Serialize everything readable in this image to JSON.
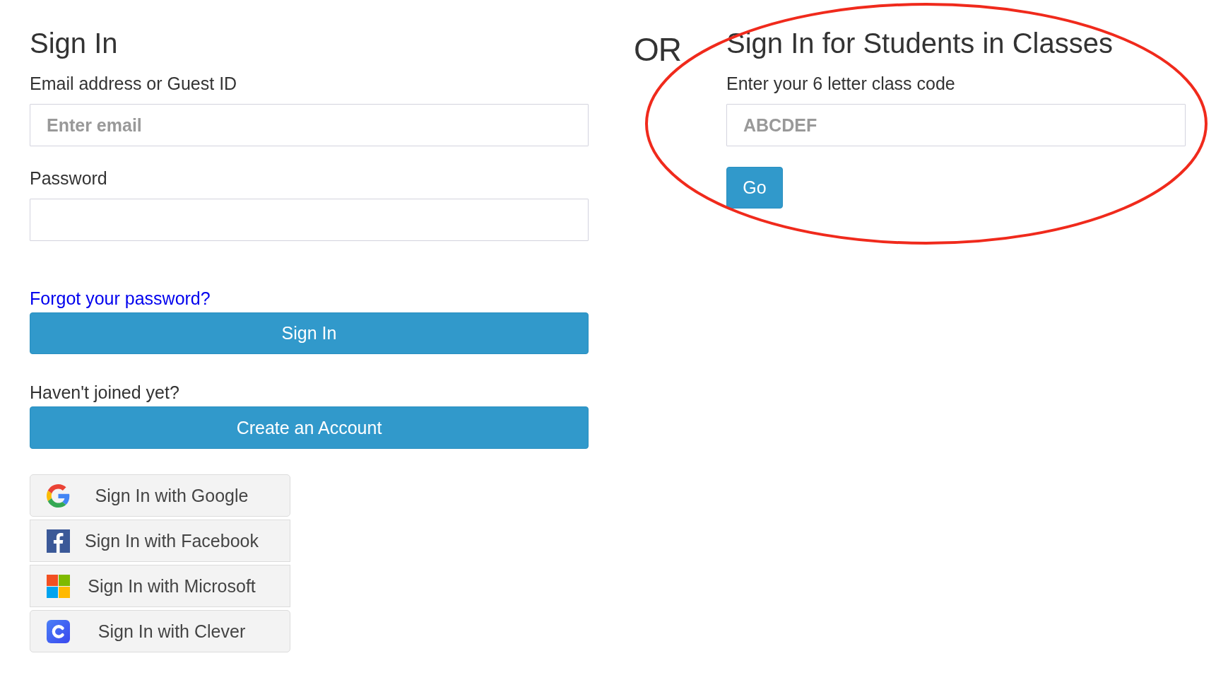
{
  "sign_in": {
    "title": "Sign In",
    "fields": [
      {
        "label": "Email address or Guest ID",
        "placeholder": "Enter email"
      },
      {
        "label": "Password"
      }
    ],
    "forgot_link": "Forgot your password?",
    "submit_button": "Sign In",
    "join_prompt": "Haven't joined yet?",
    "create_account_button": "Create an Account",
    "social_buttons": [
      {
        "kind": "google",
        "label": "Sign In with Google"
      },
      {
        "kind": "facebook",
        "label": "Sign In with Facebook"
      },
      {
        "kind": "microsoft",
        "label": "Sign In with Microsoft"
      },
      {
        "kind": "clever",
        "label": "Sign In with Clever"
      }
    ]
  },
  "separator": "OR",
  "class_sign_in": {
    "title": "Sign In for Students in Classes",
    "field": {
      "label": "Enter your 6 letter class code",
      "placeholder": "ABCDEF"
    },
    "button": "Go"
  },
  "annotations": [
    {
      "kind": "ellipse"
    }
  ]
}
